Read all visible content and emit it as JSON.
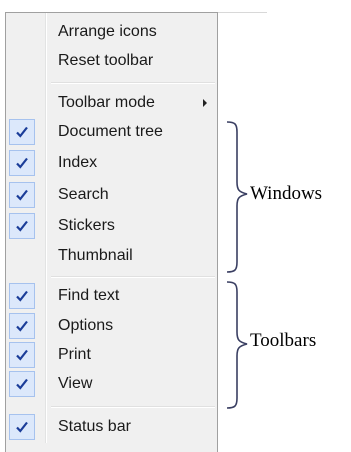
{
  "menu": {
    "items": [
      {
        "label": "Arrange icons",
        "checked": false
      },
      {
        "label": "Reset toolbar",
        "checked": false
      },
      {
        "label": "Toolbar mode",
        "checked": false,
        "submenu": true
      },
      {
        "label": "Document tree",
        "checked": true
      },
      {
        "label": "Index",
        "checked": true
      },
      {
        "label": "Search",
        "checked": true
      },
      {
        "label": "Stickers",
        "checked": true
      },
      {
        "label": "Thumbnail",
        "checked": false
      },
      {
        "label": "Find text",
        "checked": true
      },
      {
        "label": "Options",
        "checked": true
      },
      {
        "label": "Print",
        "checked": true
      },
      {
        "label": "View",
        "checked": true
      },
      {
        "label": "Status bar",
        "checked": true
      }
    ]
  },
  "annotations": {
    "windows_label": "Windows",
    "toolbars_label": "Toolbars"
  },
  "colors": {
    "menu_background": "#f0f0f0",
    "check_background": "#dce8fb",
    "check_border": "#a6c2ee",
    "checkmark": "#1b3d99",
    "brace": "#3a3f62"
  }
}
